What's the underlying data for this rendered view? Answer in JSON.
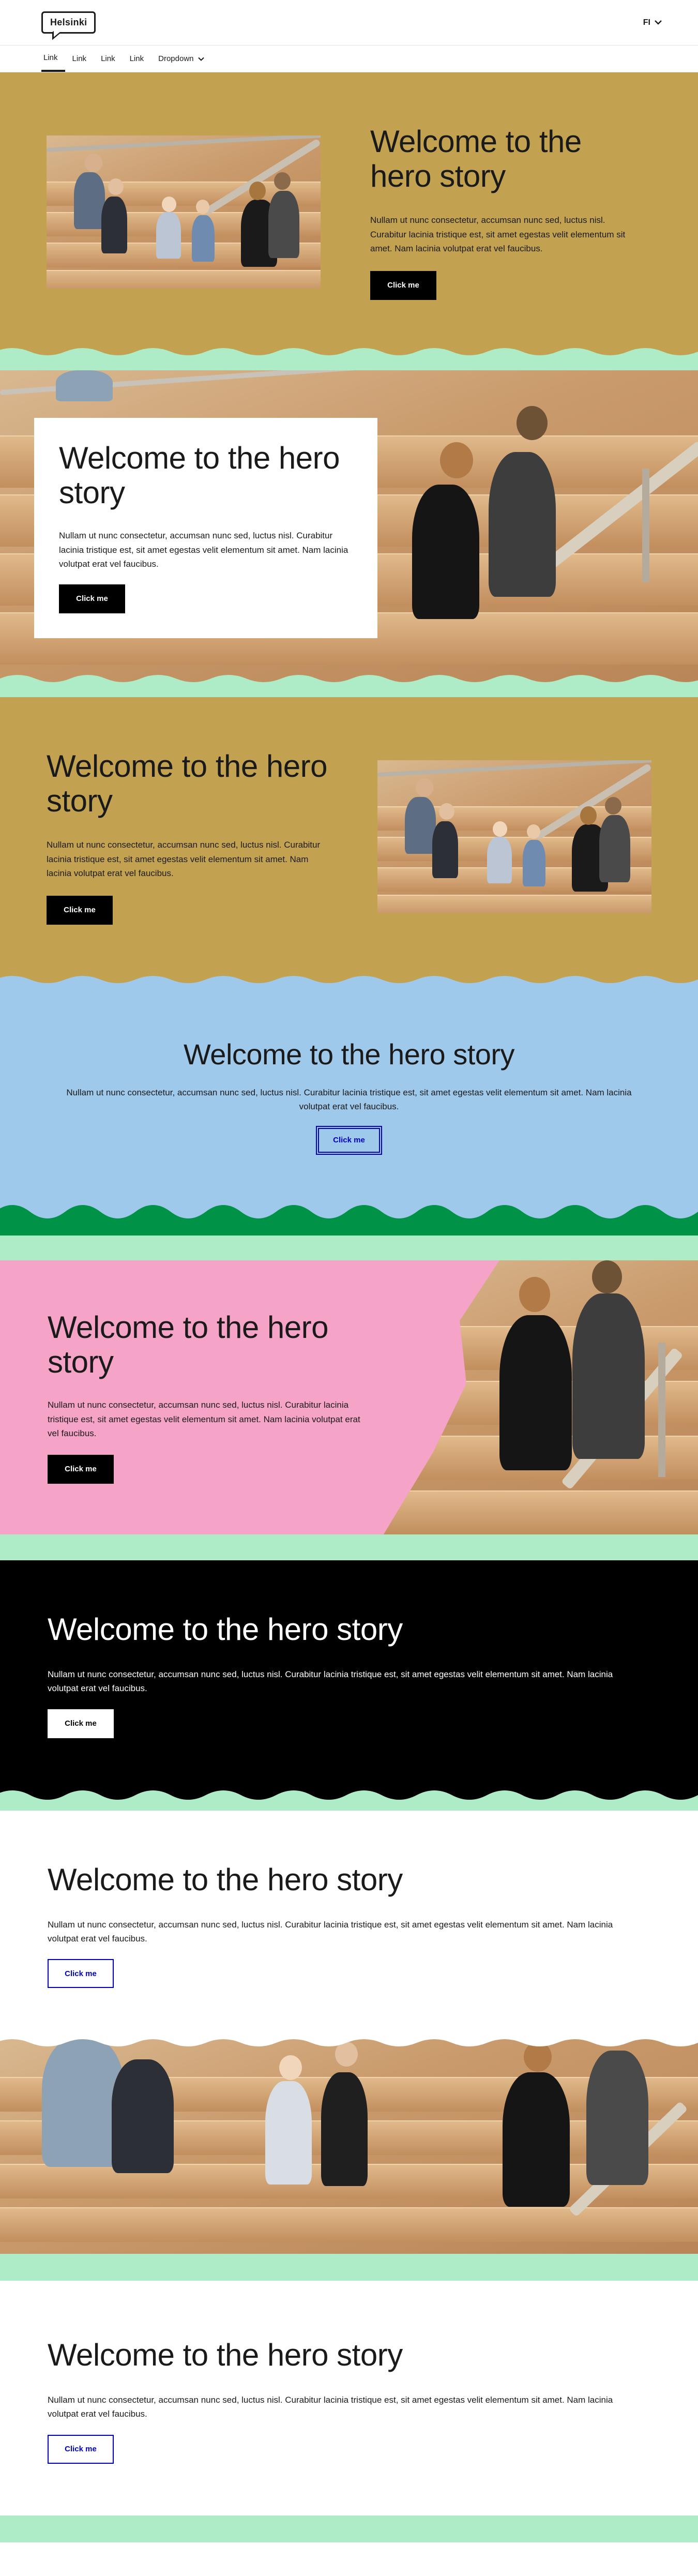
{
  "header": {
    "logo_text": "Helsinki",
    "language": "FI",
    "language_icon": "chevron-down-icon"
  },
  "nav": {
    "items": [
      {
        "label": "Link"
      },
      {
        "label": "Link"
      },
      {
        "label": "Link"
      },
      {
        "label": "Link"
      },
      {
        "label": "Dropdown"
      }
    ]
  },
  "hero": {
    "title": "Welcome to the hero story",
    "text": "Nullam ut nunc consectetur, accumsan nunc sed, luctus nisl. Curabitur lacinia tristique est, sit amet egestas velit elementum sit amet. Nam lacinia volutpat erat vel faucibus.",
    "button": "Click me"
  },
  "colors": {
    "gold": "#c2a251",
    "light_blue": "#9fc9eb",
    "pink": "#f5a3c7",
    "mint": "#aeecc7",
    "green": "#009246",
    "black": "#000000",
    "link_blue": "#0000bf"
  }
}
